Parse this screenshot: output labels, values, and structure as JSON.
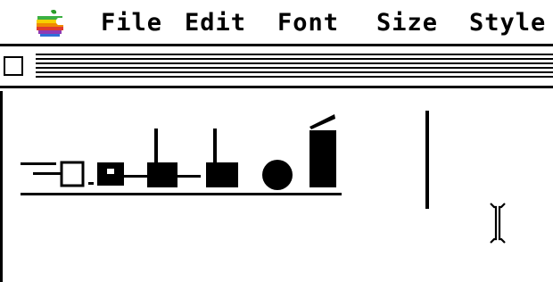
{
  "menubar": {
    "apple_icon": "apple-menu-icon",
    "items": [
      "File",
      "Edit",
      "Font",
      "Size",
      "Style"
    ]
  },
  "window": {
    "close_icon": "close-box-icon"
  },
  "document": {
    "glyph_art": "decorative-glyph-sequence",
    "cursor_icon": "i-beam-icon"
  }
}
